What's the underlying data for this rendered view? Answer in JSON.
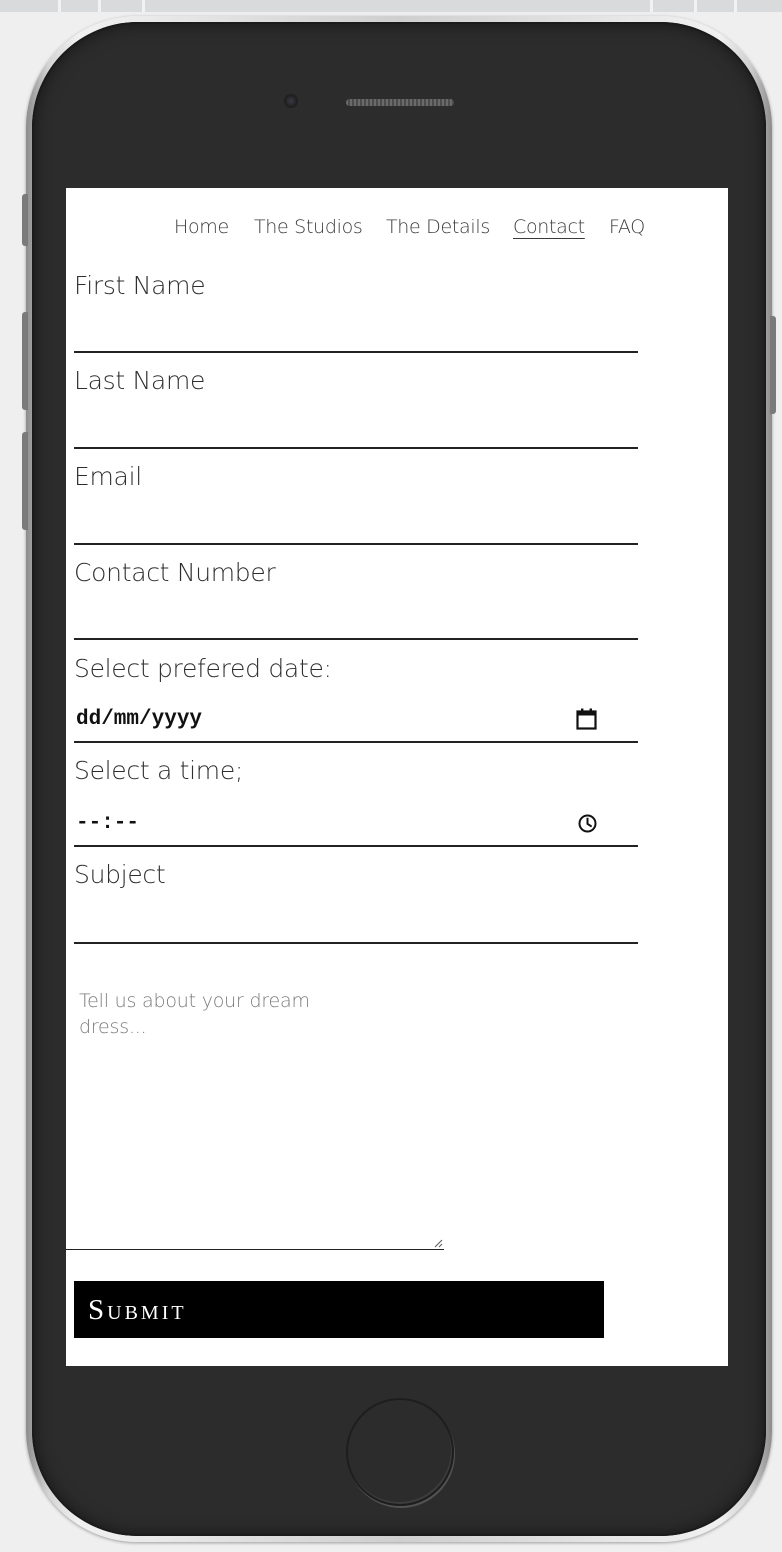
{
  "nav": {
    "items": [
      {
        "label": "Home"
      },
      {
        "label": "The Studios"
      },
      {
        "label": "The Details"
      },
      {
        "label": "Contact",
        "active": true
      },
      {
        "label": "FAQ"
      }
    ]
  },
  "form": {
    "first_name_label": "First Name",
    "last_name_label": "Last Name",
    "email_label": "Email",
    "contact_number_label": "Contact Number",
    "date_label": "Select prefered date:",
    "date_value": "dd/mm/yyyy",
    "time_label": "Select a time;",
    "time_value": "--:--",
    "subject_label": "Subject",
    "message_placeholder": "Tell us about your dream dress...",
    "submit_label": "Submit"
  },
  "colors": {
    "submit_bg": "#000000",
    "phone_body": "#2c2c2c",
    "screen_bg": "#ffffff"
  },
  "icons": {
    "date": "calendar-icon",
    "time": "clock-icon",
    "textarea": "resize-grip-icon",
    "home": "home-button"
  }
}
